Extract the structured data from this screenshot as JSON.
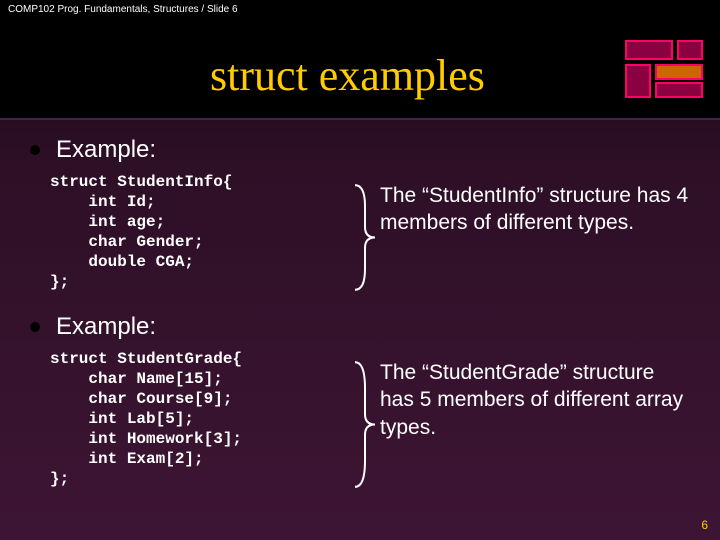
{
  "header": {
    "breadcrumb": "COMP102 Prog. Fundamentals, Structures / Slide 6"
  },
  "title": "struct examples",
  "sections": [
    {
      "label": "Example:",
      "code": "struct StudentInfo{\n    int Id;\n    int age;\n    char Gender;\n    double CGA;\n};",
      "explain": "The “StudentInfo” structure has 4 members of different types."
    },
    {
      "label": "Example:",
      "code": "struct StudentGrade{\n    char Name[15];\n    char Course[9];\n    int Lab[5];\n    int Homework[3];\n    int Exam[2];\n};",
      "explain": "The “StudentGrade” structure has 5 members of different array types."
    }
  ],
  "page_number": "6"
}
